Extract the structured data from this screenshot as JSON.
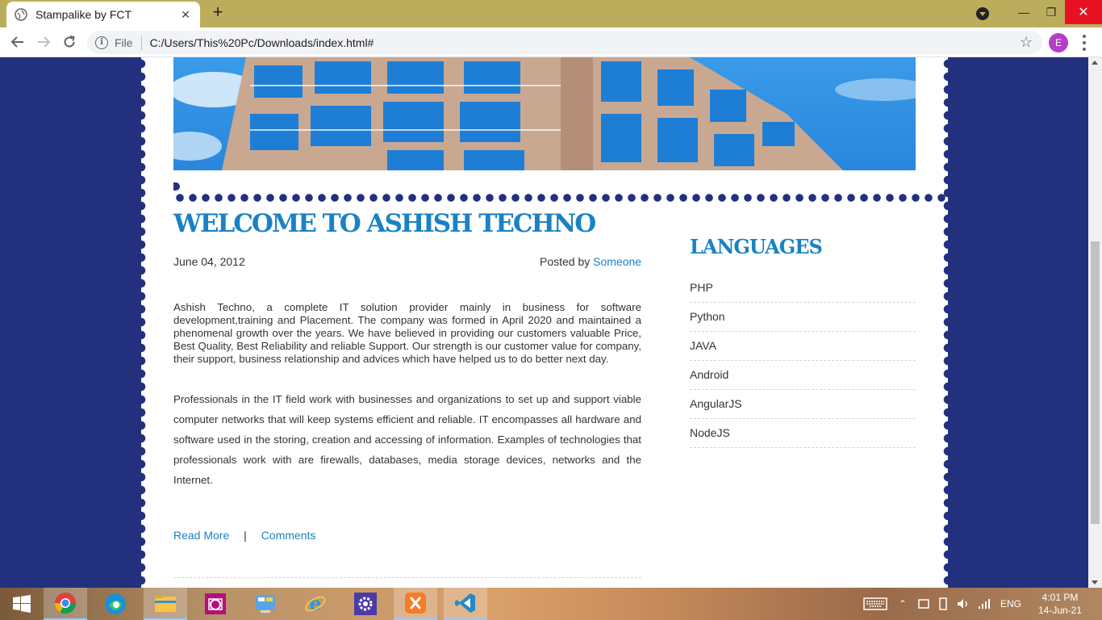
{
  "browser": {
    "tab_title": "Stampalike by FCT",
    "tab_close": "✕",
    "new_tab": "+",
    "address_scheme": "File",
    "address_url": "C:/Users/This%20Pc/Downloads/index.html#",
    "profile_initial": "E",
    "window_controls": {
      "minimize": "—",
      "maximize": "❐",
      "close": "✕"
    },
    "icons": [
      "back-icon",
      "forward-icon",
      "reload-icon",
      "info-icon",
      "star-icon",
      "menu-icon"
    ]
  },
  "post": {
    "title": "WELCOME TO ASHISH TECHNO",
    "date": "June 04, 2012",
    "posted_by_label": "Posted by",
    "author": "Someone",
    "paragraph1": "Ashish Techno, a complete IT solution provider mainly in business for software development,training and Placement. The company was formed in April 2020 and maintained a phenomenal growth over the years. We have believed in providing our customers valuable Price, Best Quality, Best Reliability and reliable Support. Our strength is our customer value for company, their support, business relationship and advices which have helped us to do better next day.",
    "paragraph2": "Professionals in the IT field work with businesses and organizations to set up and support viable computer networks that will keep systems efficient and reliable. IT encompasses all hardware and software used in the storing, creation and accessing of information. Examples of technologies that professionals work with are firewalls, databases, media storage devices, networks and the Internet.",
    "read_more": "Read More",
    "separator": "|",
    "comments": "Comments"
  },
  "sidebar": {
    "title": "LANGUAGES",
    "items": [
      "PHP",
      "Python",
      "JAVA",
      "Android",
      "AngularJS",
      "NodeJS"
    ]
  },
  "taskbar": {
    "apps": [
      "start-icon",
      "chrome-icon",
      "edge-icon",
      "file-explorer-icon",
      "camera-app-icon",
      "control-panel-icon",
      "internet-explorer-icon",
      "settings-icon",
      "xampp-icon",
      "vscode-icon"
    ],
    "language": "ENG",
    "time": "4:01 PM",
    "date": "14-Jun-21"
  },
  "colors": {
    "page_bg": "#23307e",
    "accent": "#1a82c4",
    "tabbar": "#bcad5c"
  }
}
